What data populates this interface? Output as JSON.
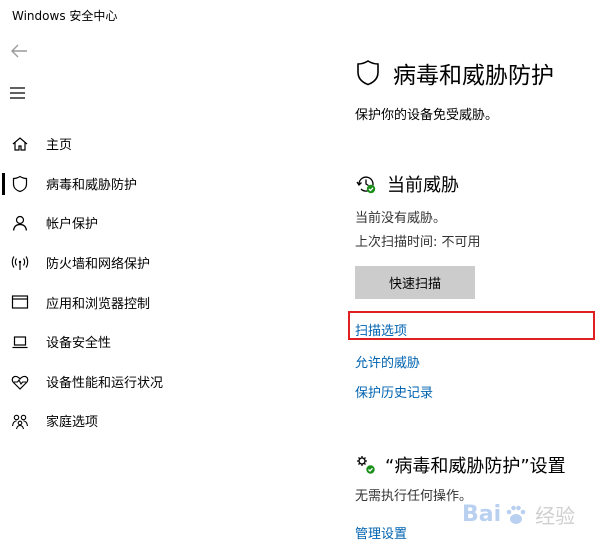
{
  "window": {
    "title": "Windows 安全中心"
  },
  "nav": {
    "items": [
      {
        "label": "主页",
        "icon": "home-icon",
        "active": false
      },
      {
        "label": "病毒和威胁防护",
        "icon": "shield-icon",
        "active": true
      },
      {
        "label": "帐户保护",
        "icon": "person-icon",
        "active": false
      },
      {
        "label": "防火墙和网络保护",
        "icon": "wifi-icon",
        "active": false
      },
      {
        "label": "应用和浏览器控制",
        "icon": "browser-icon",
        "active": false
      },
      {
        "label": "设备安全性",
        "icon": "laptop-icon",
        "active": false
      },
      {
        "label": "设备性能和运行状况",
        "icon": "heart-icon",
        "active": false
      },
      {
        "label": "家庭选项",
        "icon": "family-icon",
        "active": false
      }
    ]
  },
  "main": {
    "title": "病毒和威胁防护",
    "description": "保护你的设备免受威胁。",
    "current_threats": {
      "title": "当前威胁",
      "status": "当前没有威胁。",
      "last_scan": "上次扫描时间: 不可用",
      "quick_scan_label": "快速扫描",
      "links": {
        "scan_options": "扫描选项",
        "allowed_threats": "允许的威胁",
        "protection_history": "保护历史记录"
      }
    },
    "settings": {
      "title": "“病毒和威胁防护”设置",
      "status": "无需执行任何操作。",
      "manage_link": "管理设置"
    }
  },
  "watermark": {
    "text_left": "Bai",
    "text_right": "经验"
  },
  "colors": {
    "link": "#0063b1",
    "highlight": "#e02020",
    "button": "#cccccc",
    "check": "#1a8f1a"
  }
}
